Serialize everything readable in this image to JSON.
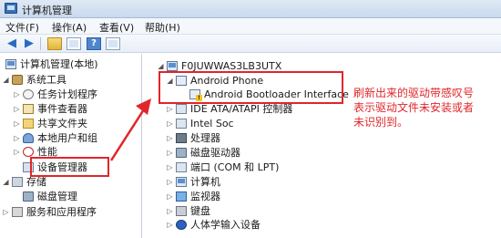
{
  "window": {
    "title": "计算机管理"
  },
  "menu": [
    "文件(F)",
    "操作(A)",
    "查看(V)",
    "帮助(H)"
  ],
  "toolbar": {
    "icons": [
      "back-arrow-icon",
      "forward-arrow-icon",
      "up-folder-icon",
      "console-tree-icon",
      "help-icon",
      "properties-icon"
    ]
  },
  "left_tree": {
    "root": "计算机管理(本地)",
    "system_tools": "系统工具",
    "items": [
      "任务计划程序",
      "事件查看器",
      "共享文件夹",
      "本地用户和组",
      "性能",
      "设备管理器"
    ],
    "storage": "存储",
    "disk_management": "磁盘管理",
    "services": "服务和应用程序"
  },
  "right_tree": {
    "computer": "F0JUWWAS3LB3UTX",
    "android_phone": "Android Phone",
    "android_bootloader": "Android Bootloader Interface",
    "categories": [
      "IDE ATA/ATAPI 控制器",
      "Intel Soc",
      "处理器",
      "磁盘驱动器",
      "端口 (COM 和 LPT)",
      "计算机",
      "监视器",
      "键盘",
      "人体学输入设备"
    ]
  },
  "annotation": {
    "lines": [
      "刷新出来的驱动带感叹号",
      "表示驱动文件未安装或者",
      "未识别到。"
    ],
    "color": "#e0262b"
  }
}
